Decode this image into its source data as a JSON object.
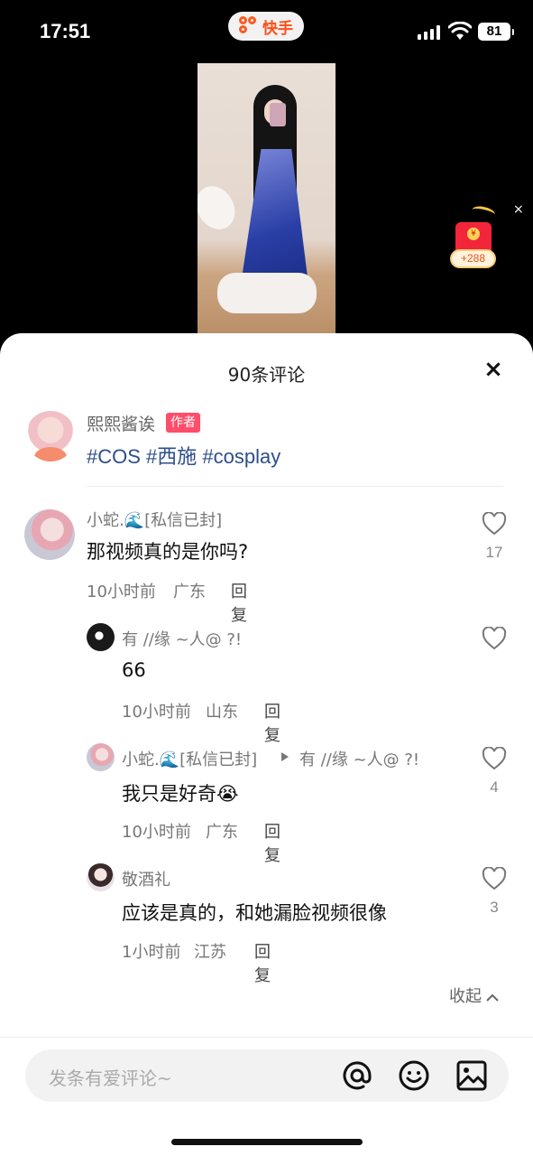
{
  "status_bar": {
    "time": "17:51",
    "app_name": "快手",
    "battery": "81"
  },
  "red_packet": {
    "amount": "+288",
    "close": "×",
    "coin": "¥"
  },
  "comments_sheet": {
    "title": "90条评论",
    "close": "×",
    "author_post": {
      "name": "熙熙酱诶",
      "badge": "作者",
      "tags": "#COS #西施 #cosplay"
    },
    "comments": [
      {
        "user": "小蛇.🌊[私信已封]",
        "text": "那视频真的是你吗?",
        "time": "10小时前",
        "location": "广东",
        "reply": "回复",
        "likes": "17"
      },
      {
        "user": "有 //缘 ~人@ ?!",
        "text": "66",
        "time": "10小时前",
        "location": "山东",
        "reply": "回复",
        "likes": ""
      },
      {
        "user": "小蛇.🌊[私信已封]",
        "reply_to": "有 //缘 ~人@ ?!",
        "text": "我只是好奇😭",
        "time": "10小时前",
        "location": "广东",
        "reply": "回复",
        "likes": "4"
      },
      {
        "user": "敬酒礼",
        "text": "应该是真的，和她漏脸视频很像",
        "time": "1小时前",
        "location": "江苏",
        "reply": "回复",
        "likes": "3"
      }
    ],
    "collapse": "收起"
  },
  "input": {
    "placeholder": "发条有爱评论~"
  },
  "icons": [
    "at-icon",
    "emoji-icon",
    "image-icon",
    "heart-icon"
  ],
  "colors": {
    "accent": "#ff4e16",
    "badge": "#ff4d6a",
    "tag": "#2d4e8a",
    "red_packet": "#f2253a"
  }
}
